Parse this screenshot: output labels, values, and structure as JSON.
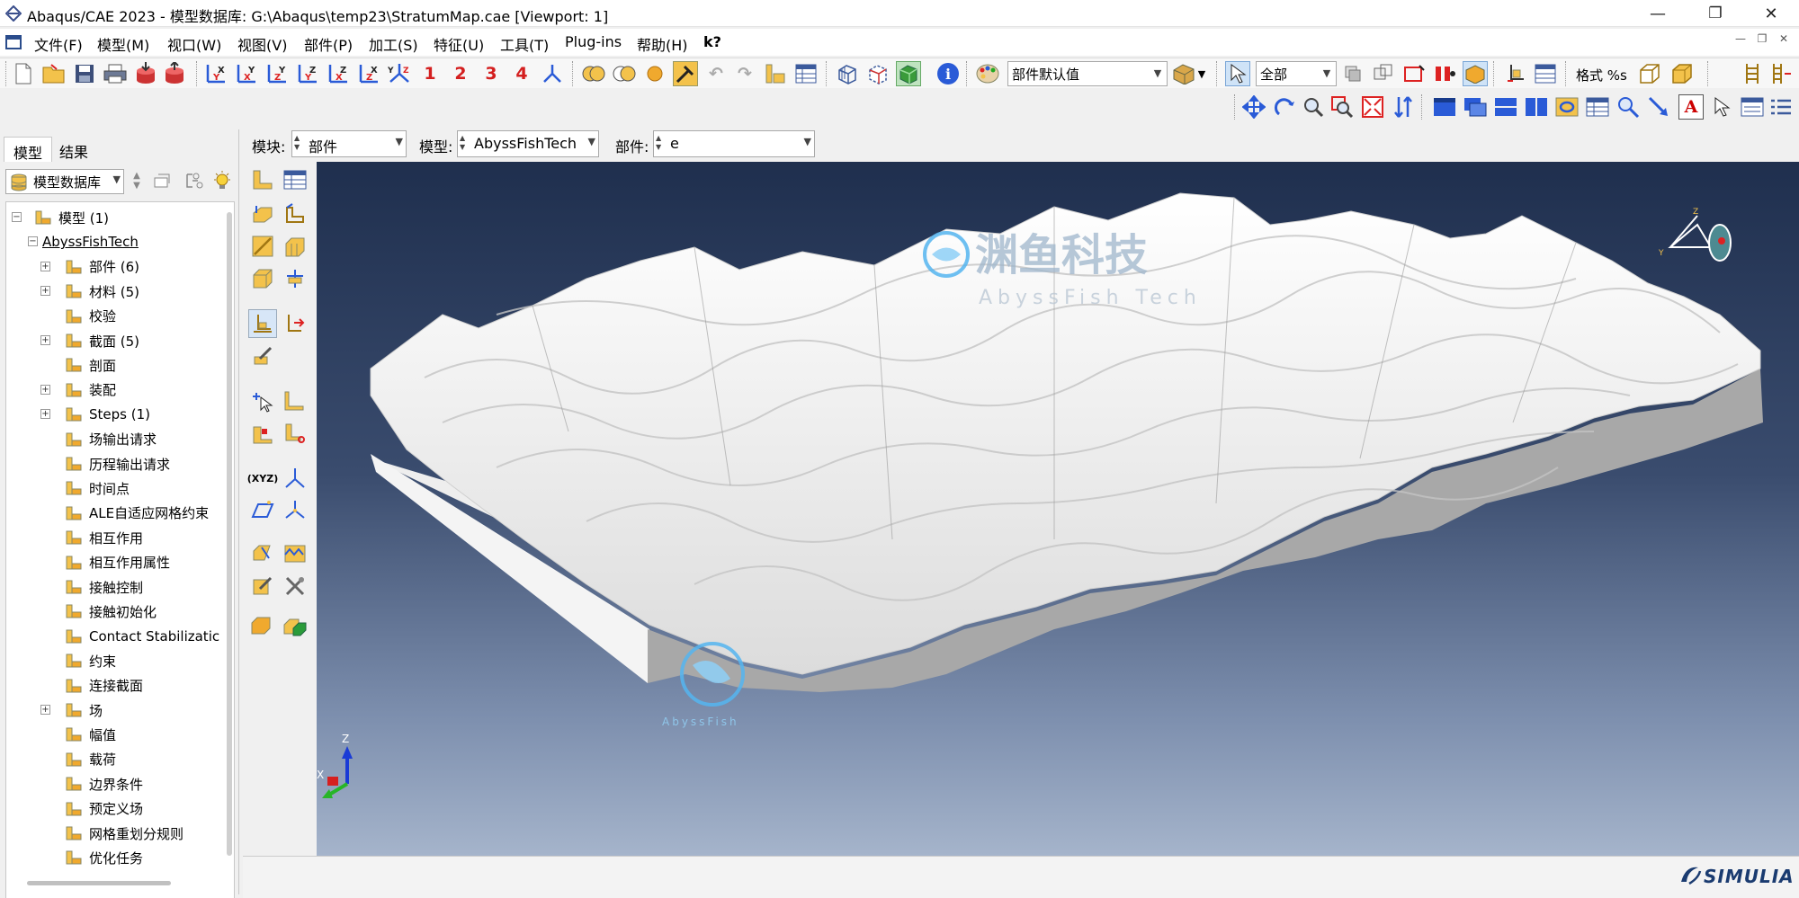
{
  "window": {
    "title": "Abaqus/CAE 2023 - 模型数据库: G:\\Abaqus\\temp23\\StratumMap.cae [Viewport: 1]",
    "minimize": "—",
    "restore": "❐",
    "close": "✕"
  },
  "menu": {
    "items": [
      "文件(F)",
      "模型(M)",
      "视口(W)",
      "视图(V)",
      "部件(P)",
      "加工(S)",
      "特征(U)",
      "工具(T)",
      "Plug-ins",
      "帮助(H)",
      "k?"
    ]
  },
  "toolbar": {
    "csys_numbers": [
      "1",
      "2",
      "3",
      "4"
    ],
    "render_style": "部件默认值",
    "selection_filter": "全部",
    "format_label": "格式 %s"
  },
  "left_panel": {
    "tabs": [
      "模型",
      "结果"
    ],
    "db_selector": "模型数据库",
    "tree": [
      {
        "label": "模型 (1)",
        "level": 0,
        "exp": "⊟",
        "icon": "models-icon"
      },
      {
        "label": "AbyssFishTech",
        "level": 1,
        "exp": "⊟",
        "icon": "",
        "underline": true
      },
      {
        "label": "部件 (6)",
        "level": 2,
        "exp": "⊞",
        "icon": "parts-icon"
      },
      {
        "label": "材料 (5)",
        "level": 2,
        "exp": "⊞",
        "icon": "materials-icon"
      },
      {
        "label": "校验",
        "level": 2,
        "exp": "",
        "icon": "calibration-icon"
      },
      {
        "label": "截面 (5)",
        "level": 2,
        "exp": "⊞",
        "icon": "sections-icon"
      },
      {
        "label": "剖面",
        "level": 2,
        "exp": "",
        "icon": "profiles-icon"
      },
      {
        "label": "装配",
        "level": 2,
        "exp": "⊞",
        "icon": "assembly-icon"
      },
      {
        "label": "Steps (1)",
        "level": 2,
        "exp": "⊞",
        "icon": "steps-icon"
      },
      {
        "label": "场输出请求",
        "level": 2,
        "exp": "",
        "icon": "field-output-icon"
      },
      {
        "label": "历程输出请求",
        "level": 2,
        "exp": "",
        "icon": "history-output-icon"
      },
      {
        "label": "时间点",
        "level": 2,
        "exp": "",
        "icon": "time-points-icon"
      },
      {
        "label": "ALE自适应网格约束",
        "level": 2,
        "exp": "",
        "icon": "ale-icon"
      },
      {
        "label": "相互作用",
        "level": 2,
        "exp": "",
        "icon": "interactions-icon"
      },
      {
        "label": "相互作用属性",
        "level": 2,
        "exp": "",
        "icon": "interaction-props-icon"
      },
      {
        "label": "接触控制",
        "level": 2,
        "exp": "",
        "icon": "contact-controls-icon"
      },
      {
        "label": "接触初始化",
        "level": 2,
        "exp": "",
        "icon": "contact-init-icon"
      },
      {
        "label": "Contact Stabilizatic",
        "level": 2,
        "exp": "",
        "icon": "contact-stabilization-icon"
      },
      {
        "label": "约束",
        "level": 2,
        "exp": "",
        "icon": "constraints-icon"
      },
      {
        "label": "连接截面",
        "level": 2,
        "exp": "",
        "icon": "connector-sections-icon"
      },
      {
        "label": "场",
        "level": 2,
        "exp": "⊞",
        "icon": "fields-icon"
      },
      {
        "label": "幅值",
        "level": 2,
        "exp": "",
        "icon": "amplitudes-icon"
      },
      {
        "label": "载荷",
        "level": 2,
        "exp": "",
        "icon": "loads-icon"
      },
      {
        "label": "边界条件",
        "level": 2,
        "exp": "",
        "icon": "bcs-icon"
      },
      {
        "label": "预定义场",
        "level": 2,
        "exp": "",
        "icon": "predefined-fields-icon"
      },
      {
        "label": "网格重划分规则",
        "level": 2,
        "exp": "",
        "icon": "remeshing-rules-icon"
      },
      {
        "label": "优化任务",
        "level": 2,
        "exp": "",
        "icon": "optimization-icon"
      }
    ]
  },
  "context": {
    "module_label": "模块:",
    "module_value": "部件",
    "model_label": "模型:",
    "model_value": "AbyssFishTech",
    "part_label": "部件:",
    "part_value": "e"
  },
  "viewport": {
    "watermark_cn": "渊鱼科技",
    "watermark_en": "AbyssFish Tech",
    "watermark_small": "AbyssFish",
    "triad": {
      "z": "Z",
      "x": "X",
      "y": "Y"
    },
    "mini_triad": {
      "z": "Z",
      "y": "Y"
    },
    "brand": "SIMULIA"
  }
}
